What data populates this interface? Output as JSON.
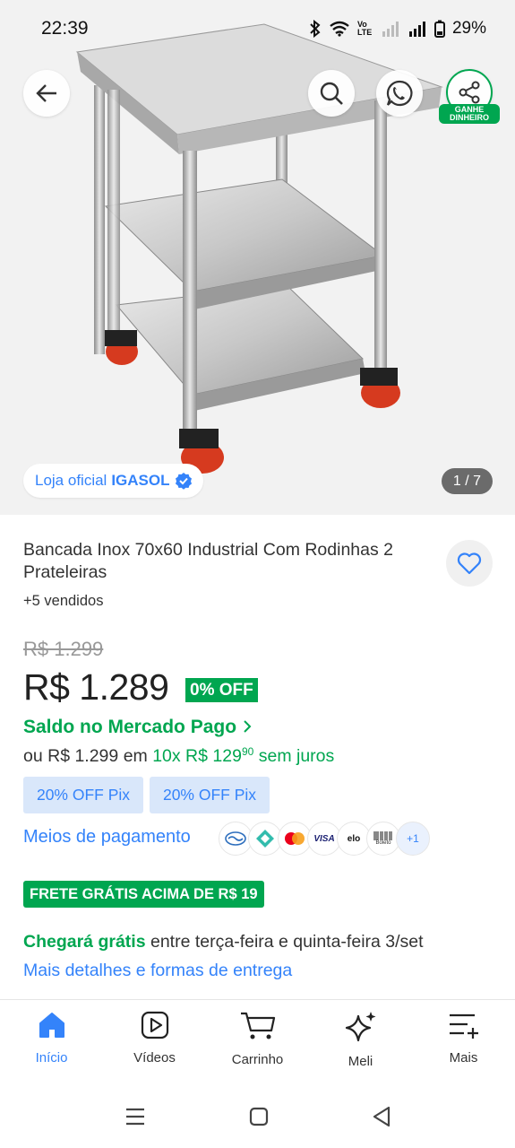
{
  "status_bar": {
    "time": "22:39",
    "battery": "29%",
    "volte": "Vo LTE"
  },
  "gallery": {
    "store_label": "Loja oficial",
    "store_name": "IGASOL",
    "counter": "1 / 7",
    "share_badge": "GANHE DINHEIRO",
    "icons": [
      "back-arrow-icon",
      "search-icon",
      "whatsapp-icon",
      "share-icon"
    ]
  },
  "product": {
    "title": "Bancada Inox 70x60 Industrial Com Rodinhas 2 Prateleiras",
    "sold": "+5 vendidos",
    "old_price": "R$ 1.299",
    "price": "R$ 1.289",
    "discount": "0% OFF",
    "saldo": "Saldo no Mercado Pago",
    "inst_prefix": "ou R$ 1.299",
    "inst_em": "em",
    "inst_amount": "10x R$ 129",
    "inst_cents": "90",
    "inst_suffix": "sem juros",
    "pix_chips": [
      "20% OFF Pix",
      "20% OFF Pix"
    ],
    "meios": "Meios de pagamento",
    "pay_more": "+1",
    "pay_visa": "VISA",
    "pay_elo": "elo",
    "pay_boleto": "Boleto",
    "frete": "FRETE GRÁTIS ACIMA DE R$ 19",
    "chegara_green": "Chegará grátis",
    "chegara_rest": "entre terça-feira e quinta-feira 3/set",
    "mais_detalhes": "Mais detalhes e formas de entrega"
  },
  "bottom_nav": [
    {
      "label": "Início",
      "icon": "home-icon",
      "active": true
    },
    {
      "label": "Vídeos",
      "icon": "video-icon",
      "active": false
    },
    {
      "label": "Carrinho",
      "icon": "cart-icon",
      "active": false
    },
    {
      "label": "Meli",
      "icon": "sparkle-icon",
      "active": false
    },
    {
      "label": "Mais",
      "icon": "menu-plus-icon",
      "active": false
    }
  ],
  "colors": {
    "accent_blue": "#3483fa",
    "green": "#00a650",
    "pix_bg": "#d9e7fa"
  }
}
